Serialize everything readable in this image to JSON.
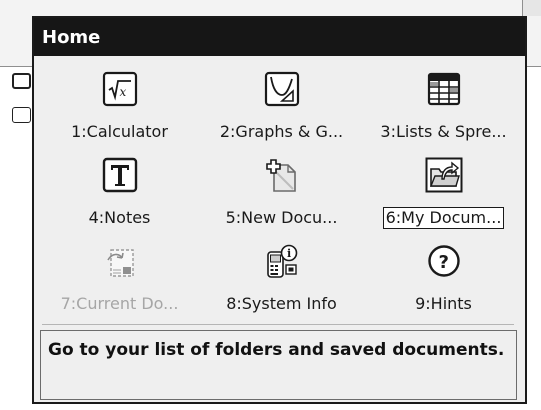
{
  "popup": {
    "title": "Home"
  },
  "menu": {
    "items": [
      {
        "label": "1:Calculator",
        "icon": "calculator-icon",
        "enabled": true,
        "selected": false
      },
      {
        "label": "2:Graphs & G...",
        "icon": "graphs-icon",
        "enabled": true,
        "selected": false
      },
      {
        "label": "3:Lists & Spre...",
        "icon": "spreadsheet-icon",
        "enabled": true,
        "selected": false
      },
      {
        "label": "4:Notes",
        "icon": "notes-icon",
        "enabled": true,
        "selected": false
      },
      {
        "label": "5:New Docu...",
        "icon": "new-document-icon",
        "enabled": true,
        "selected": false
      },
      {
        "label": "6:My Docum...",
        "icon": "my-documents-icon",
        "enabled": true,
        "selected": true
      },
      {
        "label": "7:Current Do...",
        "icon": "current-document-icon",
        "enabled": false,
        "selected": false
      },
      {
        "label": "8:System Info",
        "icon": "system-info-icon",
        "enabled": true,
        "selected": false
      },
      {
        "label": "9:Hints",
        "icon": "hints-icon",
        "enabled": true,
        "selected": false
      }
    ]
  },
  "hint": {
    "text": "Go to your list of folders and saved documents."
  },
  "colors": {
    "header_bg": "#161616",
    "popup_bg": "#efefef",
    "disabled_text": "#a6a6a6"
  }
}
